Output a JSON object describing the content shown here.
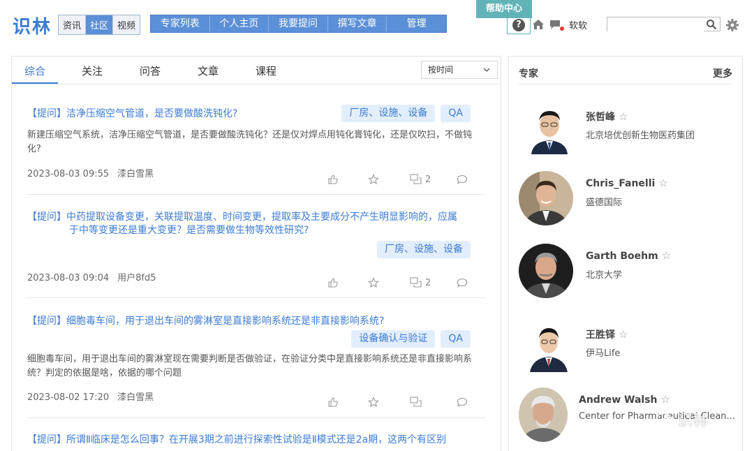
{
  "header": {
    "logo": "识林",
    "channels": [
      "资讯",
      "社区",
      "视频"
    ],
    "active_channel": 1,
    "nav": [
      "专家列表",
      "个人主页",
      "我要提问",
      "撰写文章",
      "管理"
    ],
    "help_banner": "帮助中心",
    "help_symbol": "?",
    "username": "软软",
    "search_placeholder": "",
    "icons": [
      "help-icon",
      "home-icon",
      "message-icon",
      "search-icon",
      "gear-icon"
    ]
  },
  "feed": {
    "tabs": [
      "综合",
      "关注",
      "问答",
      "文章",
      "课程"
    ],
    "active_tab": 0,
    "sort_label": "按时间",
    "questions": [
      {
        "prefix": "【提问】",
        "title_line1": "洁净压缩空气管道，是否要做酸洗钝化?",
        "title_line2": "",
        "tags": [
          "厂房、设施、设备",
          "QA"
        ],
        "desc": "新建压缩空气系统，洁净压缩空气管道，是否要做酸洗钝化？还是仅对焊点用钝化膏钝化，还是仅吹扫，不做钝化?",
        "date": "2023-08-03 09:55",
        "author": "漆白雪黑",
        "answers": "2"
      },
      {
        "prefix": "【提问】",
        "title_line1": "中药提取设备变更，关联提取温度、时间变更，提取率及主要成分不产生明显影响的，应属",
        "title_line2": "于中等变更还是重大变更？是否需要做生物等效性研究?",
        "tags": [
          "厂房、设施、设备"
        ],
        "desc": "",
        "date": "2023-08-03 09:04",
        "author": "用户8fd5",
        "answers": "2"
      },
      {
        "prefix": "【提问】",
        "title_line1": "细胞毒车间，用于退出车间的雾淋室是直接影响系统还是非直接影响系统?",
        "title_line2": "",
        "tags": [
          "设备确认与验证",
          "QA"
        ],
        "desc": "细胞毒车间，用于退出车间的雾淋室现在需要判断是否做验证，在验证分类中是直接影响系统还是非直接影响系统？判定的依据是啥，依据的哪个问题",
        "date": "2023-08-02 17:20",
        "author": "漆白雪黑",
        "answers": ""
      },
      {
        "prefix": "【提问】",
        "title_line1": "所谓Ⅱ临床是怎么回事？在开展3期之前进行探索性试验是Ⅱ模式还是2a期，这两个有区别",
        "title_line2": "",
        "tags": [],
        "desc": "",
        "date": "",
        "author": "",
        "answers": ""
      }
    ]
  },
  "experts": {
    "title": "专家",
    "more": "更多",
    "star": "☆",
    "list": [
      {
        "name": "张哲峰",
        "org": "北京培优创新生物医药集团"
      },
      {
        "name": "Chris_Fanelli",
        "org": "盛德国际"
      },
      {
        "name": "Garth Boehm",
        "org": "北京大学"
      },
      {
        "name": "王胜铎",
        "org": "伊马Life"
      },
      {
        "name": "Andrew Walsh",
        "org": "Center for Pharmaceutical Clean..."
      }
    ]
  },
  "watermark": "识林"
}
